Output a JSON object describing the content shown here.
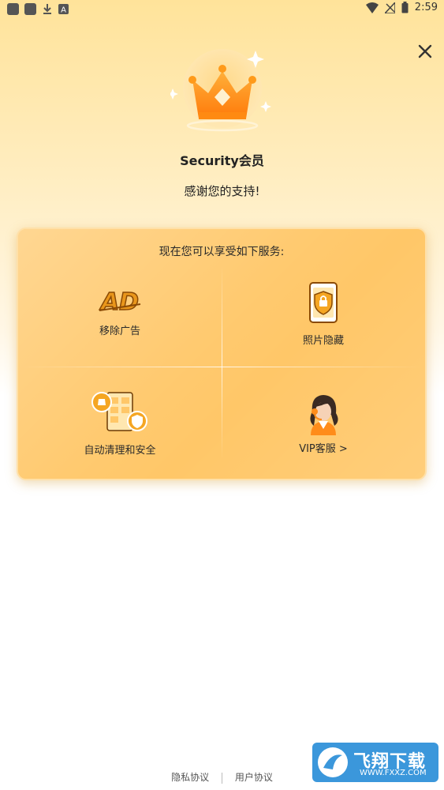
{
  "status_bar": {
    "time": "2:59"
  },
  "header": {
    "title": "Security会员",
    "subtitle": "感谢您的支持!"
  },
  "card": {
    "heading": "现在您可以享受如下服务:",
    "services": [
      {
        "label": "移除广告",
        "icon": "ad-icon"
      },
      {
        "label": "照片隐藏",
        "icon": "phone-lock-icon"
      },
      {
        "label": "自动清理和安全",
        "icon": "clean-security-icon"
      },
      {
        "label": "VIP客服 >",
        "icon": "customer-service-icon"
      }
    ]
  },
  "footer": {
    "privacy": "隐私协议",
    "user_agreement": "用户协议"
  },
  "watermark": {
    "text": "飞翔下载",
    "sub": "WWW.FXXZ.COM"
  },
  "colors": {
    "accent": "#FFC768",
    "crown": "#FF9A1A"
  }
}
